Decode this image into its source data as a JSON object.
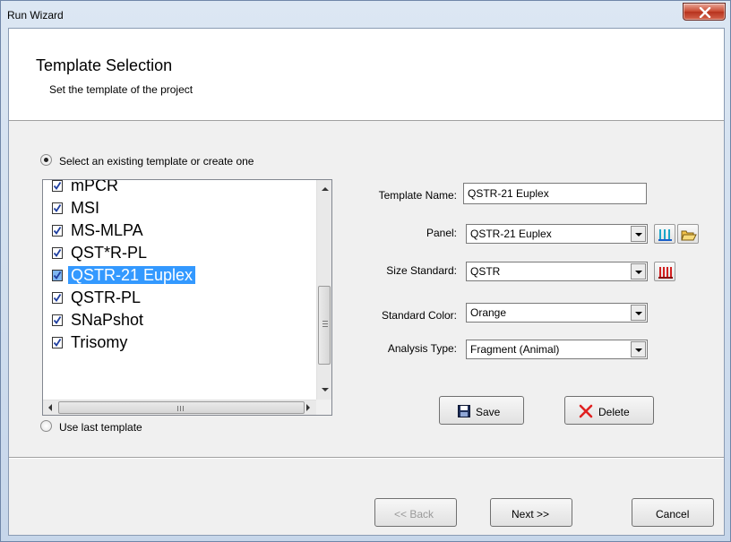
{
  "window": {
    "title": "Run Wizard"
  },
  "header": {
    "title": "Template Selection",
    "subtitle": "Set the template of the project"
  },
  "options": {
    "existing_label": "Select an existing template or create one",
    "last_label": "Use last template",
    "selected": "existing"
  },
  "template_list": {
    "items": [
      {
        "label": "mPCR",
        "checked": true,
        "selected": false
      },
      {
        "label": "MSI",
        "checked": true,
        "selected": false
      },
      {
        "label": "MS-MLPA",
        "checked": true,
        "selected": false
      },
      {
        "label": "QST*R-PL",
        "checked": true,
        "selected": false
      },
      {
        "label": "QSTR-21 Euplex",
        "checked": true,
        "selected": true
      },
      {
        "label": "QSTR-PL",
        "checked": true,
        "selected": false
      },
      {
        "label": "SNaPshot",
        "checked": true,
        "selected": false
      },
      {
        "label": "Trisomy",
        "checked": true,
        "selected": false
      }
    ]
  },
  "form": {
    "template_name_label": "Template Name:",
    "template_name_value": "QSTR-21 Euplex",
    "panel_label": "Panel:",
    "panel_value": "QSTR-21 Euplex",
    "size_standard_label": "Size Standard:",
    "size_standard_value": "QSTR",
    "standard_color_label": "Standard Color:",
    "standard_color_value": "Orange",
    "analysis_type_label": "Analysis Type:",
    "analysis_type_value": "Fragment (Animal)"
  },
  "actions": {
    "save_label": "Save",
    "delete_label": "Delete"
  },
  "footer": {
    "back_label": "<< Back",
    "next_label": "Next >>",
    "cancel_label": "Cancel"
  },
  "icons": {
    "close": "close-icon",
    "panel_view": "panel-view-icon",
    "open_folder": "open-folder-icon",
    "size_standard": "size-standard-icon",
    "save": "floppy-disk-icon",
    "delete": "red-x-icon",
    "checkbox": "checkbox-checked-icon"
  },
  "colors": {
    "selection": "#3399ff",
    "delete_red": "#e02020",
    "close_button": "#c9482f"
  }
}
